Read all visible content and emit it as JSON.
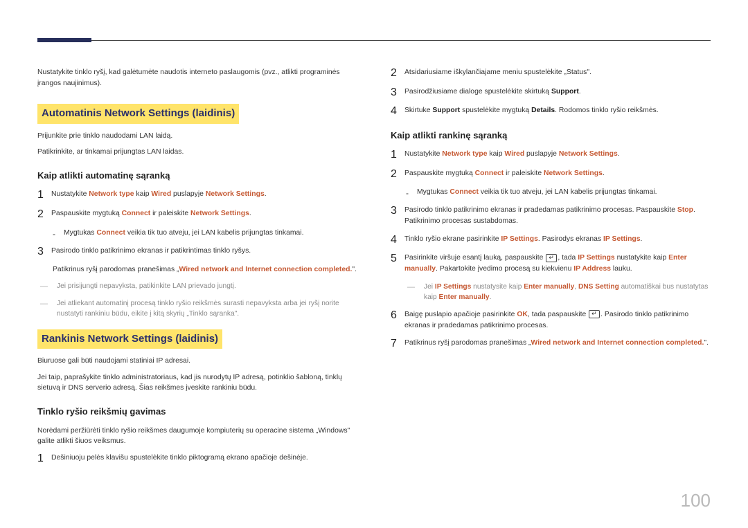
{
  "left": {
    "intro": "Nustatykite tinklo ryšį, kad galėtumėte naudotis interneto paslaugomis (pvz., atlikti programinės įrangos naujinimus).",
    "heading_auto": "Automatinis Network Settings (laidinis)",
    "auto_p1": "Prijunkite prie tinklo naudodami LAN laidą.",
    "auto_p2": "Patikrinkite, ar tinkamai prijungtas LAN laidas.",
    "sub_auto": "Kaip atlikti automatinę sąranką",
    "auto_step1_a": "Nustatykite ",
    "auto_step1_b": " kaip ",
    "auto_step1_c": " puslapyje ",
    "term_network_type": "Network type",
    "term_wired": "Wired",
    "term_network_settings": "Network Settings",
    "auto_step2_a": "Paspauskite mygtuką ",
    "auto_step2_b": " ir paleiskite ",
    "term_connect": "Connect",
    "auto_sub_a": "Mygtukas ",
    "auto_sub_b": " veikia tik tuo atveju, jei LAN kabelis prijungtas tinkamai.",
    "auto_step3": "Pasirodo tinklo patikrinimo ekranas ir patikrintimas tinklo ryšys.",
    "auto_after_a": "Patikrinus ryšį parodomas pranešimas „",
    "auto_after_msg": "Wired network and Internet connection completed.",
    "auto_after_b": "\".",
    "note_fail": "Jei prisijungti nepavyksta, patikinkite LAN prievado jungtį.",
    "note_manual": "Jei atliekant automatinį procesą tinklo ryšio reikšmės surasti nepavyksta arba jei ryšį norite nustatyti rankiniu būdu, eikite į kitą skyrių „Tinklo sąranka\".",
    "heading_manual": "Rankinis Network Settings (laidinis)",
    "man_p1": "Biuruose gali būti naudojami statiniai IP adresai.",
    "man_p2": "Jei taip, paprašykite tinklo administratoriaus, kad jis nurodytų IP adresą, potinklio šabloną, tinklų sietuvą ir DNS serverio adresą. Šias reikšmes įveskite rankiniu būdu.",
    "sub_values": "Tinklo ryšio reikšmių gavimas",
    "values_intro": "Norėdami peržiūrėti tinklo ryšio reikšmes daugumoje kompiuterių su operacine sistema „Windows\" galite atlikti šiuos veiksmus.",
    "values_step1": "Dešiniuoju pelės klavišu spustelėkite tinklo piktogramą ekrano apačioje dešinėje."
  },
  "right": {
    "step2": "Atsidariusiame iškylančiajame meniu spustelėkite „Status\".",
    "step3_a": "Pasirodžiusiame dialoge spustelėkite skirtuką ",
    "term_support": "Support",
    "step4_a": "Skirtuke ",
    "step4_b": " spustelėkite mygtuką ",
    "term_details": "Details",
    "step4_c": ". Rodomos tinklo ryšio reikšmės.",
    "sub_manual": "Kaip atlikti rankinę sąranką",
    "m_step1_a": "Nustatykite ",
    "m_step1_b": " kaip ",
    "m_step1_c": " puslapyje ",
    "m_step2_a": "Paspauskite mygtuką ",
    "m_step2_b": " ir paleiskite ",
    "m_sub_a": "Mygtukas ",
    "m_sub_b": " veikia tik tuo atveju, jei LAN kabelis prijungtas tinkamai.",
    "m_step3_a": "Pasirodo tinklo patikrinimo ekranas ir pradedamas patikrinimo procesas. Paspauskite ",
    "term_stop": "Stop",
    "m_step3_b": ". Patikrinimo procesas sustabdomas.",
    "m_step4_a": "Tinklo ryšio ekrane pasirinkite ",
    "term_ip_settings": "IP Settings",
    "m_step4_b": ". Pasirodys ekranas ",
    "m_step5_a": "Pasirinkite viršuje esantį lauką, paspauskite ",
    "m_step5_b": ", tada ",
    "m_step5_c": " nustatykite kaip ",
    "term_enter_manually": "Enter manually",
    "m_step5_d": ". Pakartokite įvedimo procesą su kiekvienu ",
    "term_ip_address": "IP Address",
    "m_step5_e": " lauku.",
    "note_dns_a": "Jei ",
    "note_dns_b": " nustatysite kaip ",
    "note_dns_c": ", ",
    "term_dns_setting": "DNS Setting",
    "note_dns_d": " automatiškai bus nustatytas kaip ",
    "m_step6_a": "Baigę puslapio apačioje pasirinkite ",
    "term_ok": "OK",
    "m_step6_b": ", tada paspauskite ",
    "m_step6_c": ". Pasirodo tinklo patikrinimo ekranas ir pradedamas patikrinimo procesas.",
    "m_step7_a": "Patikrinus ryšį parodomas pranešimas „",
    "m_step7_msg": "Wired network and Internet connection completed.",
    "m_step7_b": "\"."
  },
  "page_number": "100"
}
